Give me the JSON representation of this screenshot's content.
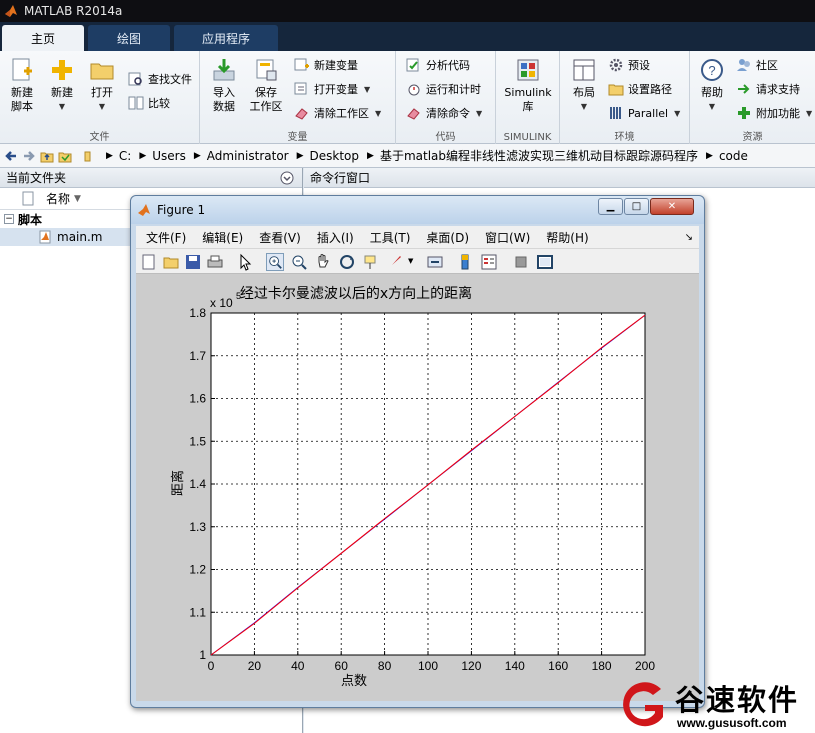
{
  "app": {
    "title": "MATLAB R2014a"
  },
  "tabs": [
    {
      "label": "主页",
      "active": true
    },
    {
      "label": "绘图",
      "active": false
    },
    {
      "label": "应用程序",
      "active": false
    }
  ],
  "ribbon": {
    "file": {
      "group_label": "文件",
      "new_script": "新建\n脚本",
      "new": "新建",
      "open": "打开",
      "find_files": "查找文件",
      "compare": "比较"
    },
    "variable": {
      "group_label": "变量",
      "import": "导入\n数据",
      "save_ws": "保存\n工作区",
      "new_var": "新建变量",
      "open_var": "打开变量",
      "clear_ws": "清除工作区"
    },
    "code": {
      "group_label": "代码",
      "analyze": "分析代码",
      "run_time": "运行和计时",
      "clear_cmd": "清除命令"
    },
    "simulink": {
      "group_label": "SIMULINK",
      "simulink": "Simulink\n库"
    },
    "env": {
      "group_label": "环境",
      "layout": "布局",
      "prefs": "预设",
      "set_path": "设置路径",
      "parallel": "Parallel"
    },
    "resources": {
      "group_label": "资源",
      "help": "帮助",
      "community": "社区",
      "support": "请求支持",
      "addons": "附加功能"
    }
  },
  "address": {
    "crumbs": [
      "C:",
      "Users",
      "Administrator",
      "Desktop",
      "基于matlab编程非线性滤波实现三维机动目标跟踪源码程序",
      "code"
    ]
  },
  "left_panel": {
    "title": "当前文件夹",
    "col_name": "名称",
    "group": "脚本",
    "file": "main.m"
  },
  "right_panel": {
    "title": "命令行窗口"
  },
  "figure": {
    "title": "Figure 1",
    "menus": [
      "文件(F)",
      "编辑(E)",
      "查看(V)",
      "插入(I)",
      "工具(T)",
      "桌面(D)",
      "窗口(W)",
      "帮助(H)"
    ]
  },
  "chart_data": {
    "type": "line",
    "title": "经过卡尔曼滤波以后的x方向上的距离",
    "xlabel": "点数",
    "ylabel": "距离",
    "exponent_label": "x 10",
    "exponent_power": "5",
    "xlim": [
      0,
      200
    ],
    "ylim": [
      1.0,
      1.8
    ],
    "xticks": [
      "0",
      "20",
      "40",
      "60",
      "80",
      "100",
      "120",
      "140",
      "160",
      "180",
      "200"
    ],
    "yticks": [
      "1",
      "1.1",
      "1.2",
      "1.3",
      "1.4",
      "1.5",
      "1.6",
      "1.7",
      "1.8"
    ],
    "grid": true,
    "series": [
      {
        "color": "#0000ff",
        "x": [
          0,
          20,
          40,
          60,
          80,
          100,
          120,
          140,
          160,
          180,
          200
        ],
        "y": [
          1.0,
          1.075,
          1.158,
          1.238,
          1.318,
          1.398,
          1.478,
          1.558,
          1.638,
          1.718,
          1.795
        ]
      },
      {
        "color": "#ff0000",
        "x": [
          0,
          20,
          40,
          60,
          80,
          100,
          120,
          140,
          160,
          180,
          200
        ],
        "y": [
          1.0,
          1.074,
          1.157,
          1.238,
          1.319,
          1.398,
          1.479,
          1.558,
          1.637,
          1.719,
          1.795
        ]
      }
    ]
  },
  "watermark": {
    "brand": "谷速软件",
    "url": "www.gususoft.com"
  }
}
